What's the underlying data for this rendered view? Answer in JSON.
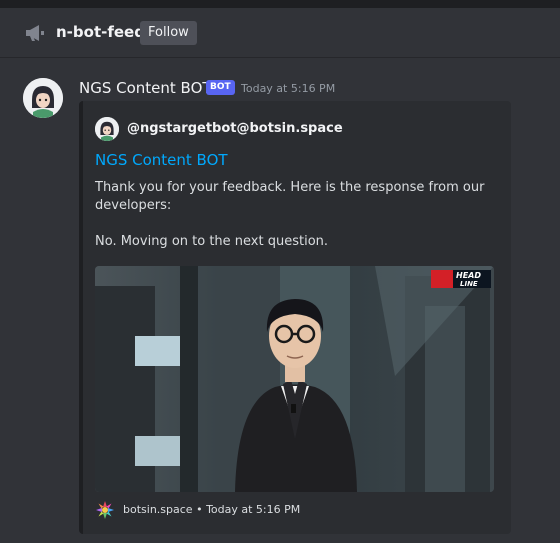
{
  "header": {
    "channel_name": "n-bot-feed",
    "follow_label": "Follow",
    "channel_icon": "megaphone-icon"
  },
  "message": {
    "author": "NGS Content BOT",
    "bot_tag": "BOT",
    "timestamp": "Today at 5:16 PM",
    "avatar_icon": "bot-avatar"
  },
  "embed": {
    "author": "@ngstargetbot@botsin.space",
    "title": "NGS Content BOT",
    "description": "Thank you for your feedback. Here is the response from our developers:\n\nNo. Moving on to the next question.",
    "image_badge": {
      "line1": "HEAD",
      "line2": "LINE"
    },
    "footer_site": "botsin.space",
    "footer_separator": "•",
    "footer_time": "Today at 5:16 PM",
    "footer_icon": "mastodon-instance-icon"
  },
  "colors": {
    "background": "#313338",
    "embed_bg": "#2b2d31",
    "link": "#00a8fc",
    "bot_tag": "#5865f2",
    "follow_btn": "#4e5058"
  }
}
